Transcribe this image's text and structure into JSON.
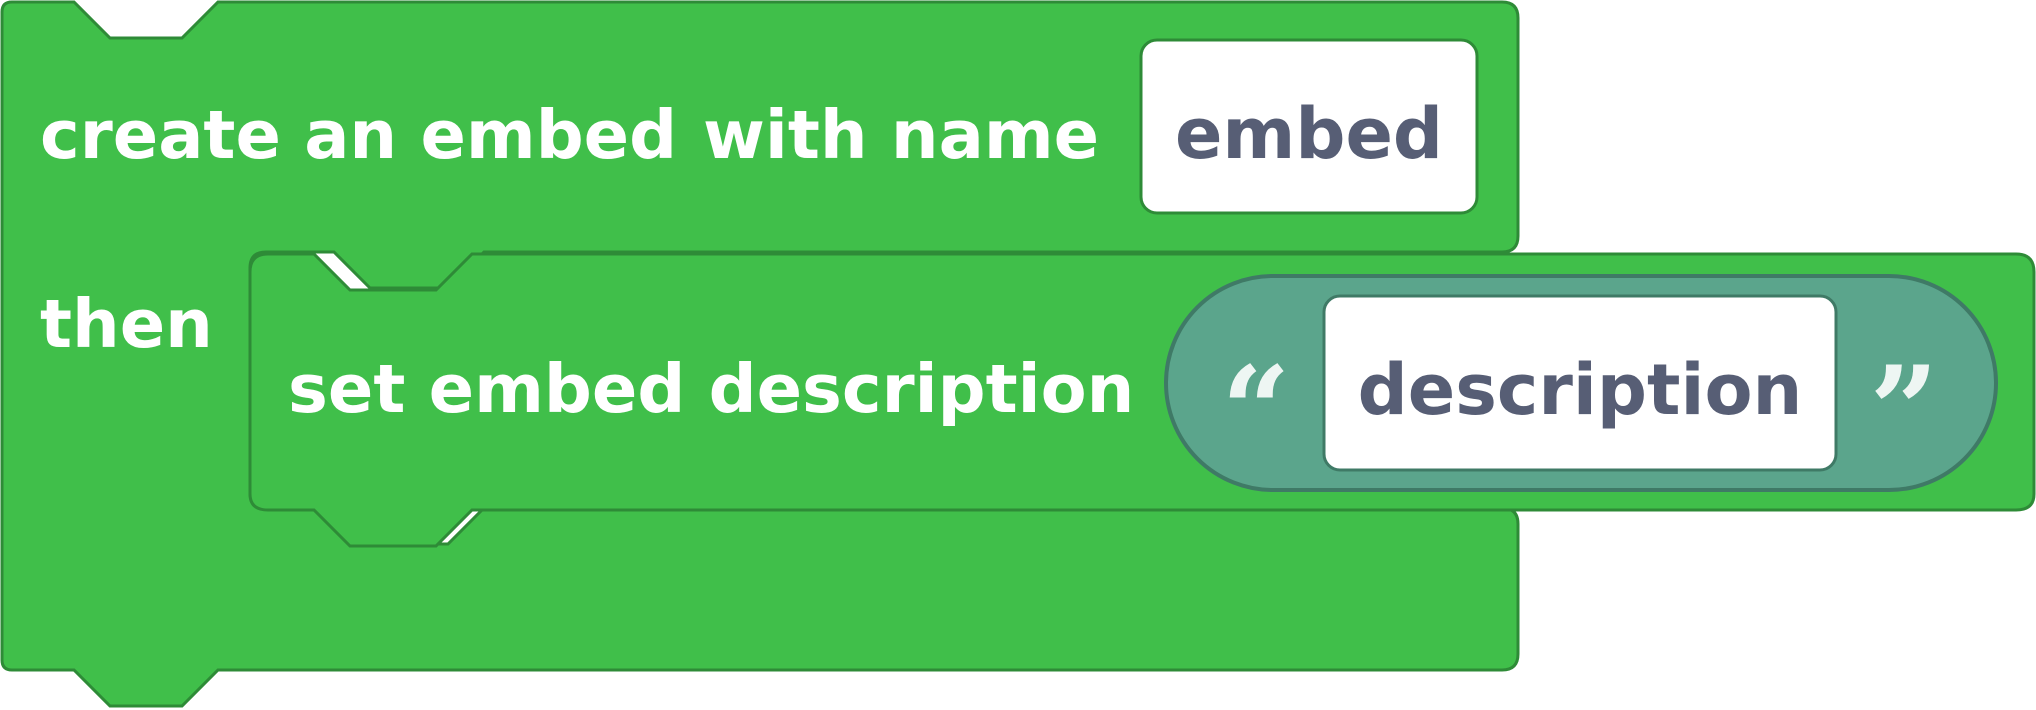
{
  "outer_block": {
    "label_create": "create an embed",
    "label_with_name": "with name",
    "name_field_value": "embed",
    "label_then": "then",
    "color": "#40BF4A",
    "border_color": "#2E8B37"
  },
  "inner_block": {
    "label": "set embed description",
    "color": "#40BF4A"
  },
  "text_reporter": {
    "open_quote": "“",
    "close_quote": "”",
    "value": "description",
    "color": "#5BA58C",
    "border_color": "#3F7A66"
  }
}
